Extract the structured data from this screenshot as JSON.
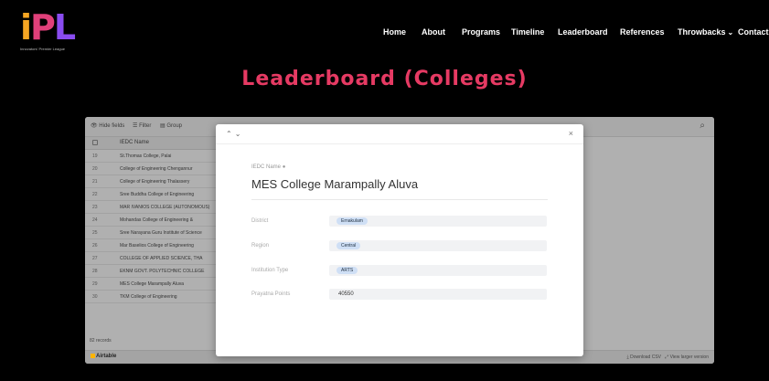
{
  "brand": {
    "logo_text": "iPL",
    "logo_subtext": "Innovators' Premier League"
  },
  "nav": {
    "items": [
      {
        "label": "Home"
      },
      {
        "label": "About"
      },
      {
        "label": "Programs"
      },
      {
        "label": "Timeline"
      },
      {
        "label": "Leaderboard"
      },
      {
        "label": "References"
      },
      {
        "label": "Throwbacks"
      },
      {
        "label": "Contact"
      }
    ]
  },
  "page": {
    "title": "Leaderboard (Colleges)"
  },
  "embed": {
    "toolbar": {
      "hide_fields": "Hide fields",
      "filter": "Filter",
      "group": "Group"
    },
    "column_header": "IEDC Name",
    "rows": [
      {
        "num": "19",
        "name": "St.Thomas College, Palai"
      },
      {
        "num": "20",
        "name": "College of Engineering Chengannur"
      },
      {
        "num": "21",
        "name": "College of Engineering Thalassery"
      },
      {
        "num": "22",
        "name": "Sree Buddha College of Engineering"
      },
      {
        "num": "23",
        "name": "MAR IVANIOS COLLEGE (AUTONOMOUS)"
      },
      {
        "num": "24",
        "name": "Mohandas College of Engineering &"
      },
      {
        "num": "25",
        "name": "Sree Narayana Guru Institute of Science"
      },
      {
        "num": "26",
        "name": "Mar Baselios College of Engineering"
      },
      {
        "num": "27",
        "name": "COLLEGE OF APPLIED SCIENCE, THA"
      },
      {
        "num": "28",
        "name": "EKNM GOVT. POLYTECHNIC COLLEGE"
      },
      {
        "num": "29",
        "name": "MES College Marampally Aluva"
      },
      {
        "num": "30",
        "name": "TKM College of Engineering"
      }
    ],
    "record_count": "82 records",
    "footer": {
      "brand": "Airtable",
      "download": "Download CSV",
      "view_larger": "View larger version"
    }
  },
  "modal": {
    "primary_field_label": "IEDC Name",
    "record_title": "MES College Marampally Aluva",
    "fields": [
      {
        "label": "District",
        "value": "Ernakulam",
        "type": "chip"
      },
      {
        "label": "Region",
        "value": "Central",
        "type": "chip"
      },
      {
        "label": "Institution Type",
        "value": "ARTS",
        "type": "chip"
      },
      {
        "label": "Prayatna Points",
        "value": "40550",
        "type": "number"
      }
    ]
  }
}
